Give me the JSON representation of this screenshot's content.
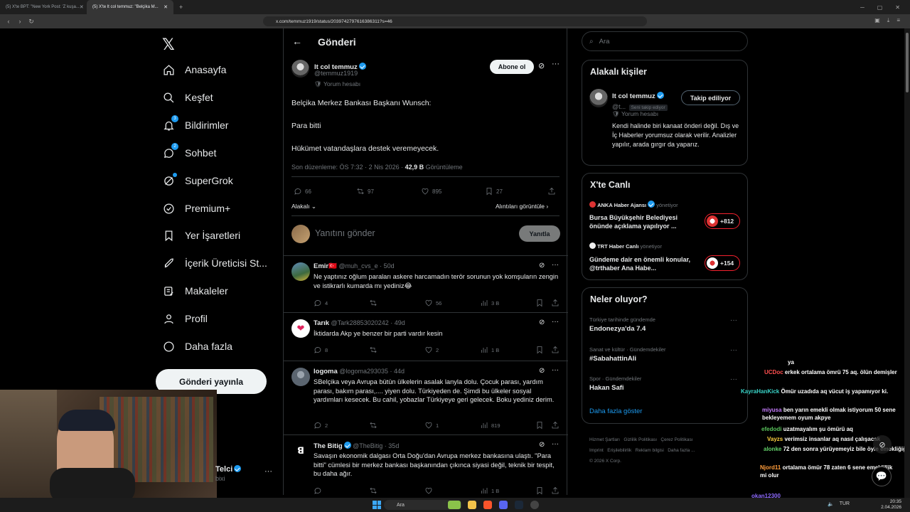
{
  "browser": {
    "tabs": [
      {
        "label": "(5) X'te BPT: \"New York Post: 'Z kuşa..."
      },
      {
        "label": "(5) X'te lt col temmuz: \"Belçika M..."
      }
    ],
    "url": "x.com/temmuz1919/status/2039742797616386311?s=46"
  },
  "nav": {
    "items": [
      {
        "label": "Anasayfa"
      },
      {
        "label": "Keşfet"
      },
      {
        "label": "Bildirimler",
        "badge": "3"
      },
      {
        "label": "Sohbet",
        "badge": "2"
      },
      {
        "label": "SuperGrok"
      },
      {
        "label": "Premium+"
      },
      {
        "label": "Yer İşaretleri"
      },
      {
        "label": "İçerik Üreticisi St..."
      },
      {
        "label": "Makaleler"
      },
      {
        "label": "Profil"
      },
      {
        "label": "Daha fazla"
      }
    ],
    "post_button": "Gönderi yayınla",
    "account_name": "Telci",
    "account_handle": "bixi"
  },
  "header": {
    "title": "Gönderi"
  },
  "tweet": {
    "name": "lt col temmuz",
    "handle": "@temmuz1919",
    "label": "Yorum hesabı",
    "subscribe": "Abone ol",
    "lines": [
      "Belçika Merkez Bankası Başkanı Wunsch:",
      "Para bitti",
      "Hükümet vatandaşlara destek veremeyecek."
    ],
    "edited": "Son düzenleme: ÖS 7:32 · 2 Nis 2026 · ",
    "views": "42,9 B",
    "views_label": " Görüntüleme",
    "replies": "66",
    "retweets": "97",
    "likes": "895",
    "bookmarks": "27",
    "sort": "Alakalı",
    "quotes": "Alıntıları görüntüle"
  },
  "composer": {
    "placeholder": "Yanıtını gönder",
    "button": "Yanıtla"
  },
  "replies": [
    {
      "name": "Emir🇹🇷",
      "handle": "@muh_cvs_e · 50d",
      "text": "Ne yaptınız oğlum paraları askere harcamadın terör sorunun yok komşuların zengin ve istikrarlı kumarda mı yediniz😂",
      "r": "4",
      "rt": "",
      "l": "56",
      "v": "3 B"
    },
    {
      "name": "Tarık",
      "handle": "@Tark28853020242 · 49d",
      "text": "İktidarda Akp ye benzer bir parti vardır kesin",
      "r": "8",
      "rt": "",
      "l": "2",
      "v": "1 B"
    },
    {
      "name": "logoma",
      "handle": "@logoma293035 · 44d",
      "text": "SBelçika veya Avrupa bütün ülkelerin asalak lanyla dolu. Çocuk parası, yardım parası, bakım parası,.... yiyen dolu. Türkiyeden de. Şimdi bu ülkeler sosyal yardımları kesecek. Bu cahil, yobazlar Türkiyeye geri gelecek. Boku yediniz derim.",
      "r": "2",
      "rt": "",
      "l": "1",
      "v": "819"
    },
    {
      "name": "The Bitig",
      "handle": "@TheBitig · 35d",
      "text": "Savaşın ekonomik dalgası Orta Doğu'dan Avrupa merkez bankasına ulaştı. \"Para bitti\" cümlesi bir merkez bankası başkanından çıkınca siyasi değil, teknik bir tespit, bu daha ağır.",
      "r": "",
      "rt": "",
      "l": "",
      "v": "1 B"
    }
  ],
  "right": {
    "search_placeholder": "Ara",
    "related_title": "Alakalı kişiler",
    "related": {
      "name": "lt col temmuz",
      "handle": "@t...",
      "follows_you": "Seni takip ediyor",
      "label": "Yorum hesabı",
      "button": "Takip ediliyor",
      "bio": "Kendi halinde biri kanaat önderi değil. Dış ve İç Haberler yorumsuz olarak verilir. Analizler yapılır, arada gırgır da yaparız."
    },
    "live_title": "X'te Canlı",
    "live": [
      {
        "host": "ANKA Haber Ajansı",
        "role": "yönetiyor",
        "title": "Bursa Büyükşehir Belediyesi önünde açıklama yapılıyor ...",
        "count": "+812"
      },
      {
        "host": "TRT Haber Canlı",
        "role": "yönetiyor",
        "title": "Gündeme dair en önemli konular, @trthaber Ana Habe...",
        "count": "+154"
      }
    ],
    "trends_title": "Neler oluyor?",
    "trends": [
      {
        "sub": "Türkiye tarihinde gündemde",
        "main": "Endonezya'da 7.4"
      },
      {
        "sub": "Sanat ve kültür · Gündemdekiler",
        "main": "#SabahattinAli"
      },
      {
        "sub": "Spor · Gündemdekiler",
        "main": "Hakan Safi"
      }
    ],
    "show_more": "Daha fazla göster",
    "footer": [
      "Hizmet Şartları",
      "Gizlilik Politikası",
      "Çerez Politikası",
      "Imprint",
      "Erişilebilirlik",
      "Reklam bilgisi",
      "Daha fazla ...",
      "© 2026 X Corp."
    ]
  },
  "chat": [
    {
      "user": "",
      "msg": "ya",
      "color": "#ffffff"
    },
    {
      "user": "UCDoc",
      "msg": "erkek ortalama ömrü 75 aq. ölün demişler",
      "color": "#ff4f4f"
    },
    {
      "user": "KayraHanKick",
      "msg": "Ömür uzadıda aq vücut iş yapamıyor ki.",
      "color": "#39d4c8"
    },
    {
      "user": "miyusa",
      "msg": "ben yarın emekli olmak istiyorum 50 sene bekleyemem oyum akpye",
      "color": "#c77dff"
    },
    {
      "user": "efedodi",
      "msg": "uzatmayalım şu ömürü aq",
      "color": "#59c35c"
    },
    {
      "user": "Vayzs",
      "msg": "verimsiz insanlar aq nasıl çalışacak",
      "color": "#ffd23f"
    },
    {
      "user": "alonke",
      "msg": "72 den sonra yürüyemeyiz bile öyle emekliğiğ",
      "color": "#64d36a"
    },
    {
      "user": "Njord11",
      "msg": "ortalama ömür 78 zaten 6 sene emeklillik mi olur",
      "color": "#ff9d3b"
    },
    {
      "user": "okan12300",
      "msg": "",
      "color": "#8f6bff"
    }
  ],
  "taskbar": {
    "search": "Ara",
    "lang": "TUR",
    "time": "20:35",
    "date": "2.04.2026"
  }
}
